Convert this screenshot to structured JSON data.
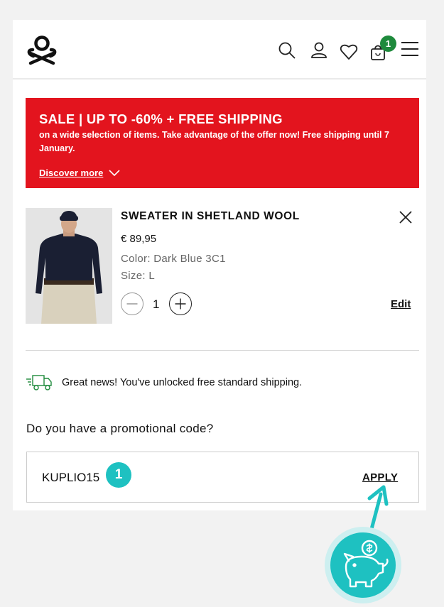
{
  "header": {
    "logo": "benetton-knot-logo",
    "icons": [
      "search-icon",
      "user-icon",
      "heart-icon",
      "bag-icon",
      "menu-icon"
    ],
    "cart_count": "1"
  },
  "banner": {
    "title": "SALE | UP TO -60% + FREE SHIPPING",
    "text": "on a wide selection of items. Take advantage of the offer now! Free shipping until 7 January.",
    "link": "Discover more",
    "color": "#e3141e"
  },
  "product": {
    "name": "SWEATER IN SHETLAND WOOL",
    "price": "€ 89,95",
    "color": "Color: Dark Blue 3C1",
    "size": "Size: L",
    "quantity": "1",
    "edit_label": "Edit"
  },
  "shipping": {
    "message": "Great news! You've unlocked free standard shipping."
  },
  "promo": {
    "question": "Do you have a promotional code?",
    "code": "KUPLIO15",
    "apply_label": "APPLY"
  },
  "overlay": {
    "step": "1",
    "accent": "#1ec1c1"
  }
}
